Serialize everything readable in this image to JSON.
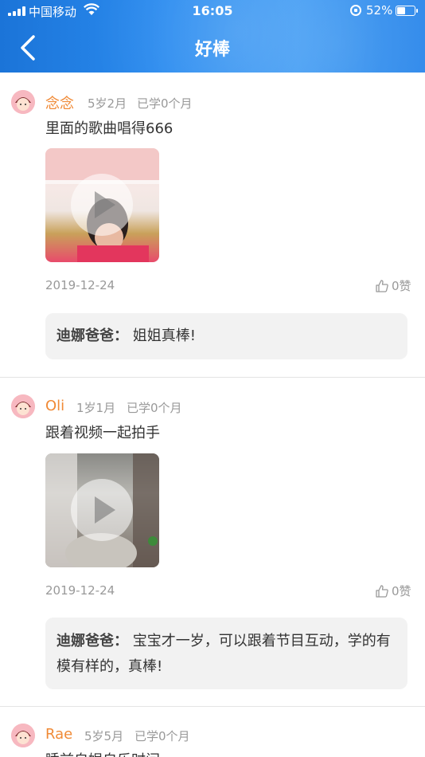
{
  "status_bar": {
    "carrier": "中国移动",
    "time": "16:05",
    "battery_percent": "52%",
    "battery_level": 0.52
  },
  "header": {
    "title": "好棒",
    "back_icon": "chevron-left-icon"
  },
  "posts": [
    {
      "name": "念念",
      "age": "5岁2月",
      "study": "已学0个月",
      "text": "里面的歌曲唱得666",
      "date": "2019-12-24",
      "likes": "0赞",
      "reply_author": "迪娜爸爸：",
      "reply_text": "姐姐真棒!"
    },
    {
      "name": "Oli",
      "age": "1岁1月",
      "study": "已学0个月",
      "text": "跟着视频一起拍手",
      "date": "2019-12-24",
      "likes": "0赞",
      "reply_author": "迪娜爸爸：",
      "reply_text": "宝宝才一岁，可以跟着节目互动，学的有模有样的，真棒!"
    },
    {
      "name": "Rae",
      "age": "5岁5月",
      "study": "已学0个月",
      "text": "睡前自娱自乐时间"
    }
  ],
  "colors": {
    "header_blue": "#2b8cf0",
    "name_orange": "#f08a36"
  }
}
